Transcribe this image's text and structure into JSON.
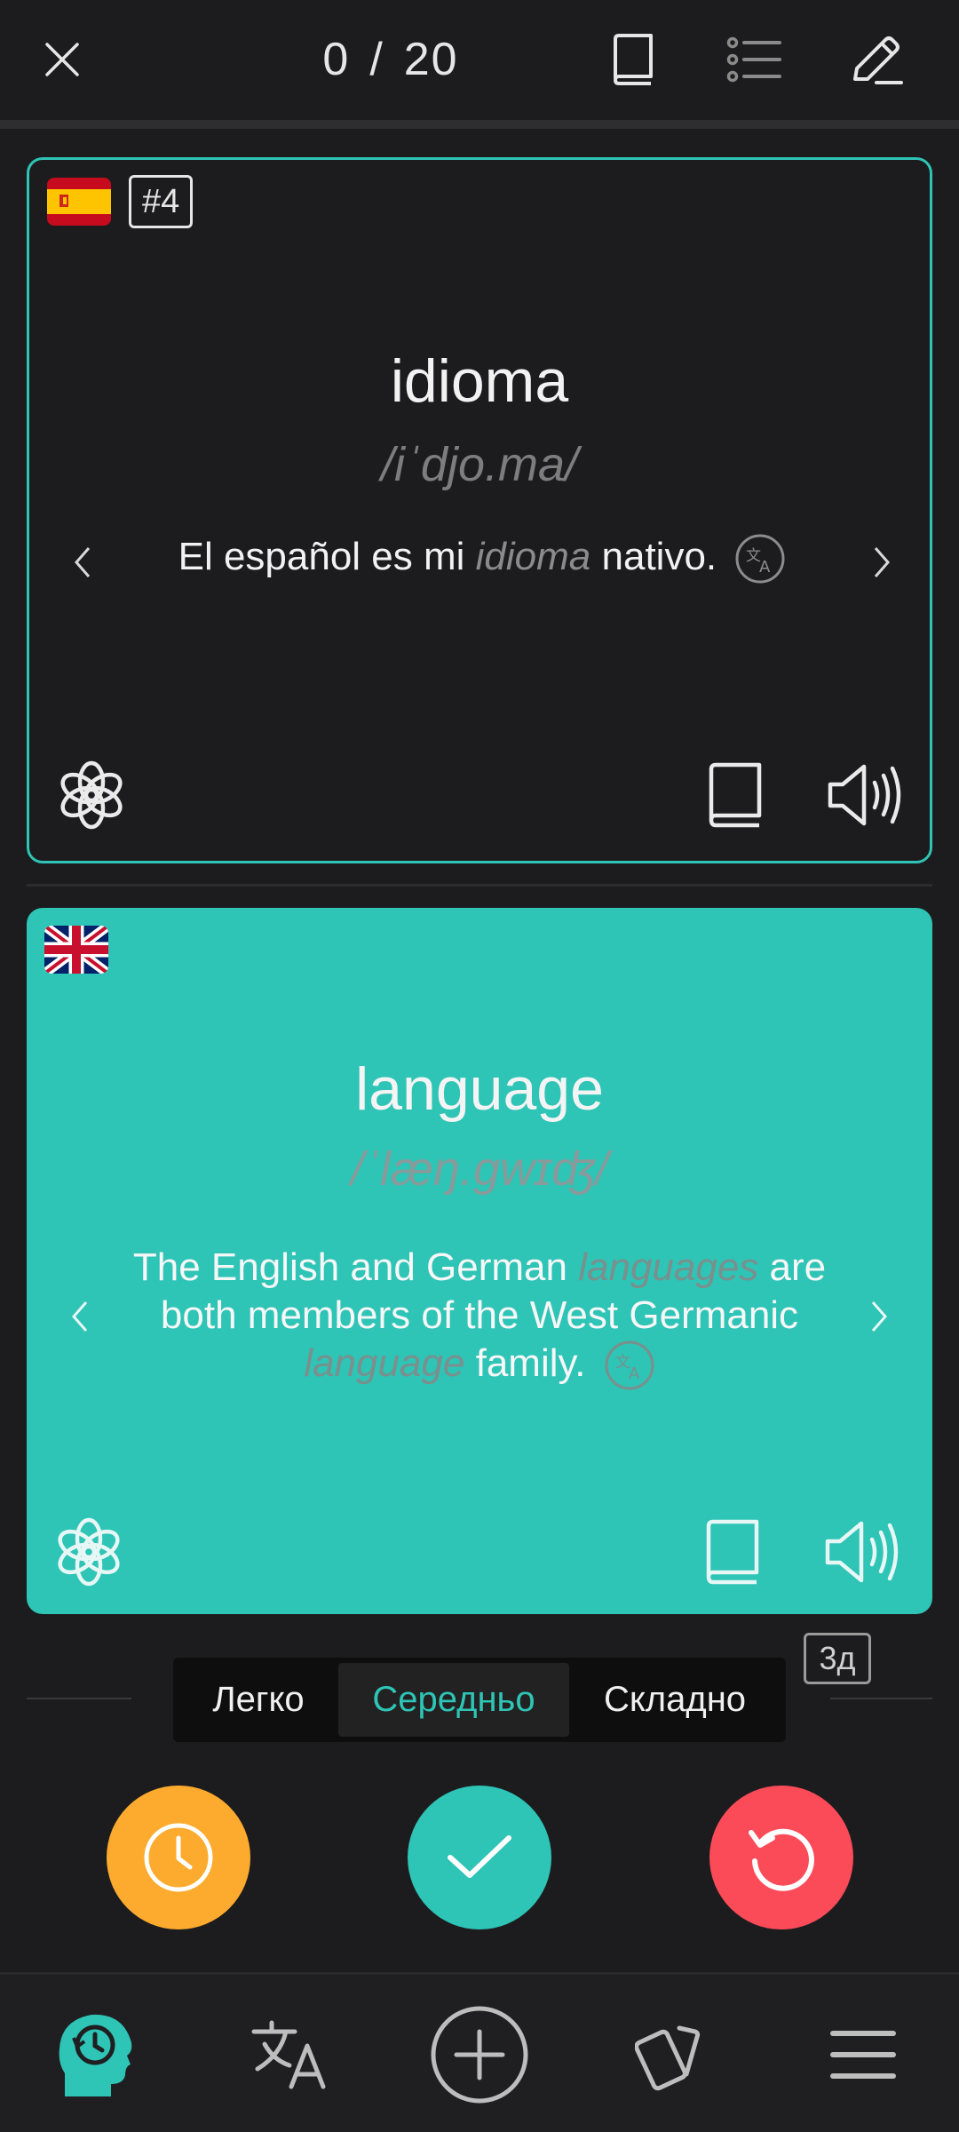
{
  "header": {
    "current": "0",
    "separator": "/",
    "total": "20",
    "icons": [
      "close-icon",
      "dictionary-icon",
      "list-icon",
      "edit-icon"
    ]
  },
  "front_card": {
    "language": "Spanish",
    "flag": "flag-es",
    "number_badge": "#4",
    "word": "idioma",
    "transcription": "/iˈdjo.ma/",
    "example": {
      "before": "El español es mi ",
      "highlight": "idioma",
      "after": " nativo."
    }
  },
  "back_card": {
    "language": "English",
    "flag": "flag-uk",
    "word": "language",
    "transcription": "/ˈlæŋ.ɡwɪʤ/",
    "example": {
      "part1": "The English and German ",
      "highlight1": "languages",
      "part2": " are both members of the West Germanic ",
      "highlight2": "language",
      "part3": " family."
    }
  },
  "interval_badge": "3д",
  "difficulty": {
    "options": [
      "Легко",
      "Середньо",
      "Складно"
    ],
    "selected": "Середньо"
  },
  "actions": [
    {
      "name": "later",
      "icon": "clock-icon",
      "color": "#fdab2e"
    },
    {
      "name": "know",
      "icon": "check-icon",
      "color": "#2ec4b6"
    },
    {
      "name": "repeat",
      "icon": "repeat-icon",
      "color": "#fb4b59"
    }
  ],
  "bottom_nav": {
    "items": [
      "learning-head-icon",
      "translate-icon",
      "add-icon",
      "cards-icon",
      "menu-icon"
    ],
    "active": "learning-head-icon"
  },
  "colors": {
    "accent": "#2ec4b6",
    "background": "#1c1c1e",
    "orange": "#fdab2e",
    "red": "#fb4b59"
  }
}
